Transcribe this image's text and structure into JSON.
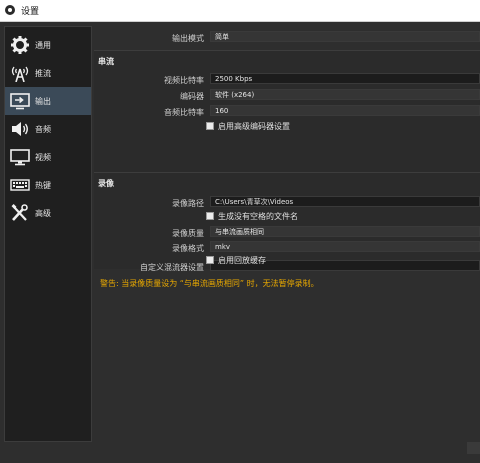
{
  "window": {
    "title": "设置"
  },
  "sidebar": {
    "items": [
      {
        "label": "通用",
        "icon": "gear-icon"
      },
      {
        "label": "推流",
        "icon": "antenna-icon"
      },
      {
        "label": "输出",
        "icon": "output-icon"
      },
      {
        "label": "音频",
        "icon": "speaker-icon"
      },
      {
        "label": "视频",
        "icon": "monitor-icon"
      },
      {
        "label": "热键",
        "icon": "keyboard-icon"
      },
      {
        "label": "高级",
        "icon": "tools-icon"
      }
    ],
    "active_index": 2
  },
  "output_mode": {
    "label": "输出模式",
    "value": "简单"
  },
  "streaming": {
    "title": "串流",
    "video_bitrate": {
      "label": "视频比特率",
      "value": "2500 Kbps"
    },
    "encoder": {
      "label": "编码器",
      "value": "软件 (x264)"
    },
    "audio_bitrate": {
      "label": "音频比特率",
      "value": "160"
    },
    "advanced_encoder": {
      "label": "启用高级编码器设置",
      "checked": false
    }
  },
  "recording": {
    "title": "录像",
    "path": {
      "label": "录像路径",
      "value": "C:\\Users\\青草次\\Videos"
    },
    "no_space": {
      "label": "生成没有空格的文件名",
      "checked": false
    },
    "quality": {
      "label": "录像质量",
      "value": "与串流画质相同"
    },
    "format": {
      "label": "录像格式",
      "value": "mkv"
    },
    "muxer": {
      "label": "自定义混流器设置",
      "value": ""
    },
    "replay_buffer": {
      "label": "启用回放缓存",
      "checked": false
    }
  },
  "warning": "警告: 当录像质量设为 “与串流画质相同” 时，无法暂停录制。",
  "colors": {
    "active_nav": "#3b4a58",
    "warning": "#e8a800",
    "background": "#2e2e2e"
  }
}
